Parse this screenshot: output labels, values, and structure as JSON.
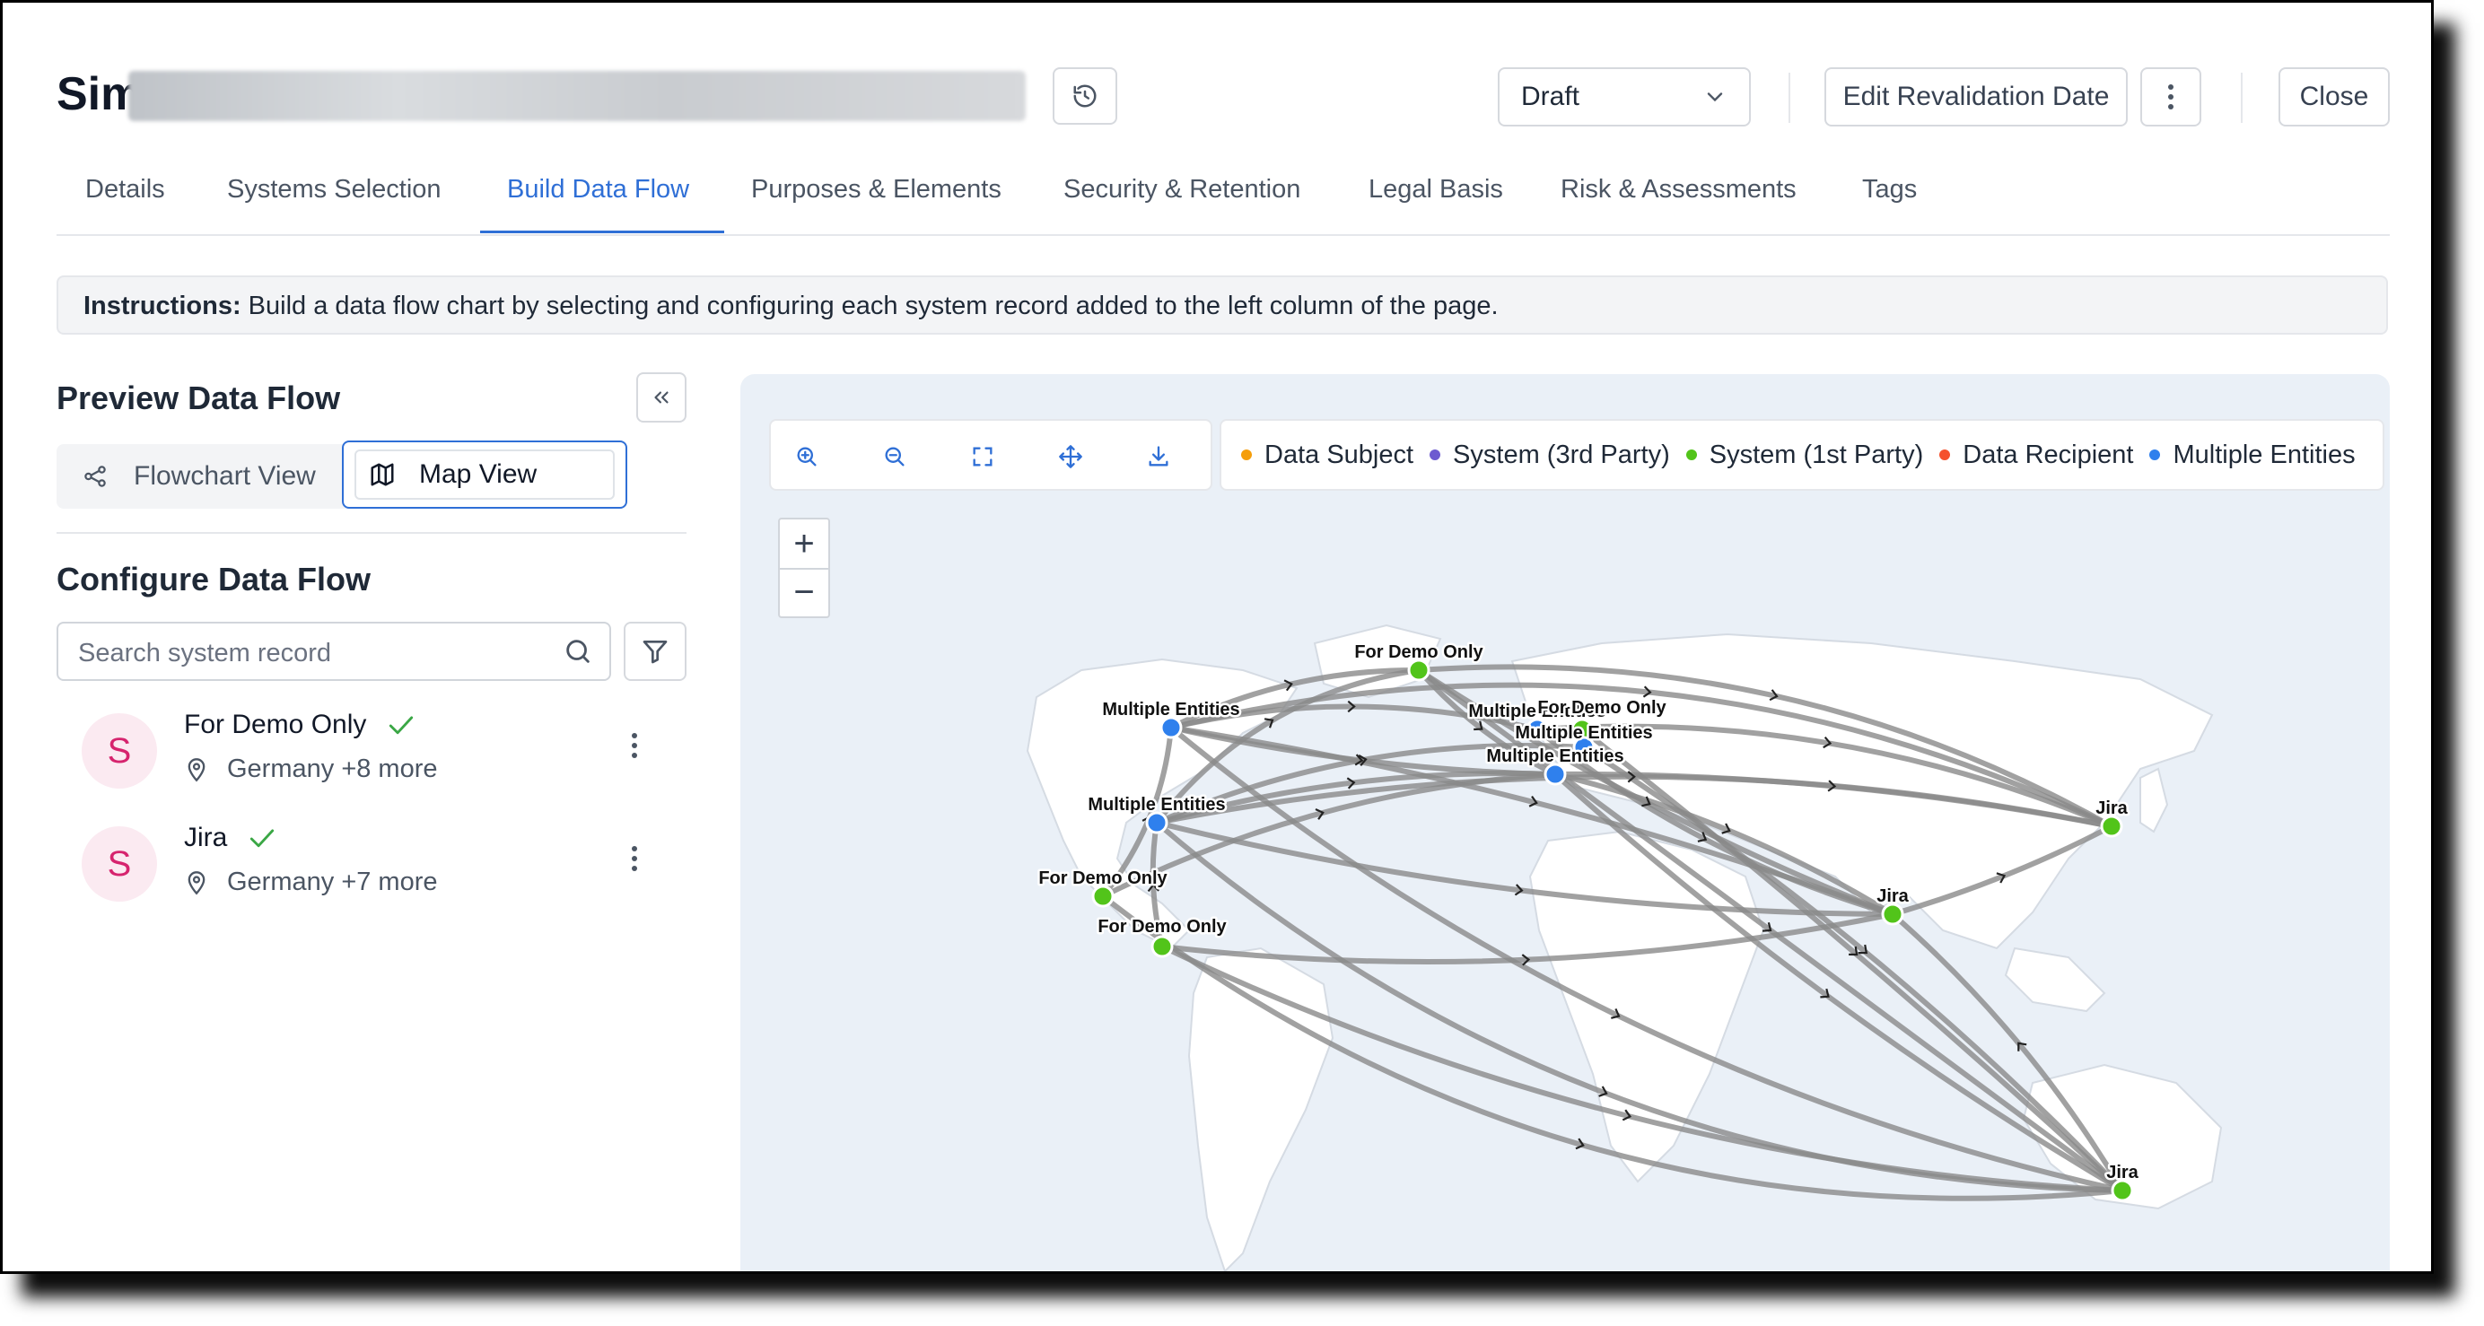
{
  "header": {
    "title_visible": "Sim",
    "status": "Draft",
    "revalidation_label": "Edit Revalidation Date",
    "close_label": "Close"
  },
  "tabs": [
    {
      "label": "Details"
    },
    {
      "label": "Systems Selection"
    },
    {
      "label": "Build Data Flow",
      "active": true
    },
    {
      "label": "Purposes & Elements"
    },
    {
      "label": "Security & Retention"
    },
    {
      "label": "Legal Basis"
    },
    {
      "label": "Risk & Assessments"
    },
    {
      "label": "Tags"
    }
  ],
  "instructions": {
    "prefix": "Instructions:",
    "text": " Build a data flow chart by selecting and configuring each system record added to the left column of the page."
  },
  "preview": {
    "title": "Preview Data Flow",
    "views": {
      "flowchart": "Flowchart View",
      "map": "Map View"
    },
    "active_view": "map"
  },
  "configure": {
    "title": "Configure Data Flow",
    "search_placeholder": "Search system record",
    "records": [
      {
        "initial": "S",
        "name": "For Demo Only",
        "location": "Germany +8 more",
        "configured": true
      },
      {
        "initial": "S",
        "name": "Jira",
        "location": "Germany +7 more",
        "configured": true
      }
    ]
  },
  "map": {
    "toolbar": [
      "zoom-in-icon",
      "zoom-out-icon",
      "fit-screen-icon",
      "pan-icon",
      "download-icon"
    ],
    "legend": [
      {
        "label": "Data Subject",
        "color": "#f59e0b"
      },
      {
        "label": "System (3rd Party)",
        "color": "#6d5bd0"
      },
      {
        "label": "System (1st Party)",
        "color": "#52c41a"
      },
      {
        "label": "Data Recipient",
        "color": "#f5512d"
      },
      {
        "label": "Multiple Entities",
        "color": "#2f80ed"
      }
    ],
    "zoom_in": "+",
    "zoom_out": "−",
    "node_labels": {
      "demo_north": "For Demo Only",
      "multi_west_top": "Multiple Entities",
      "multi_west_mid": "Multiple Entities",
      "demo_west_1": "For Demo Only",
      "demo_west_2": "For Demo Only",
      "multi_eu_1": "Multiple Entities",
      "demo_eu": "For Demo Only",
      "multi_eu_2": "Multiple Entities",
      "multi_eu_3": "Multiple Entities",
      "jira_east": "Jira",
      "jira_india": "Jira",
      "jira_aus": "Jira"
    },
    "colors": {
      "multi": "#2f80ed",
      "first_party": "#52c41a",
      "edge": "#7c7c7c"
    }
  }
}
